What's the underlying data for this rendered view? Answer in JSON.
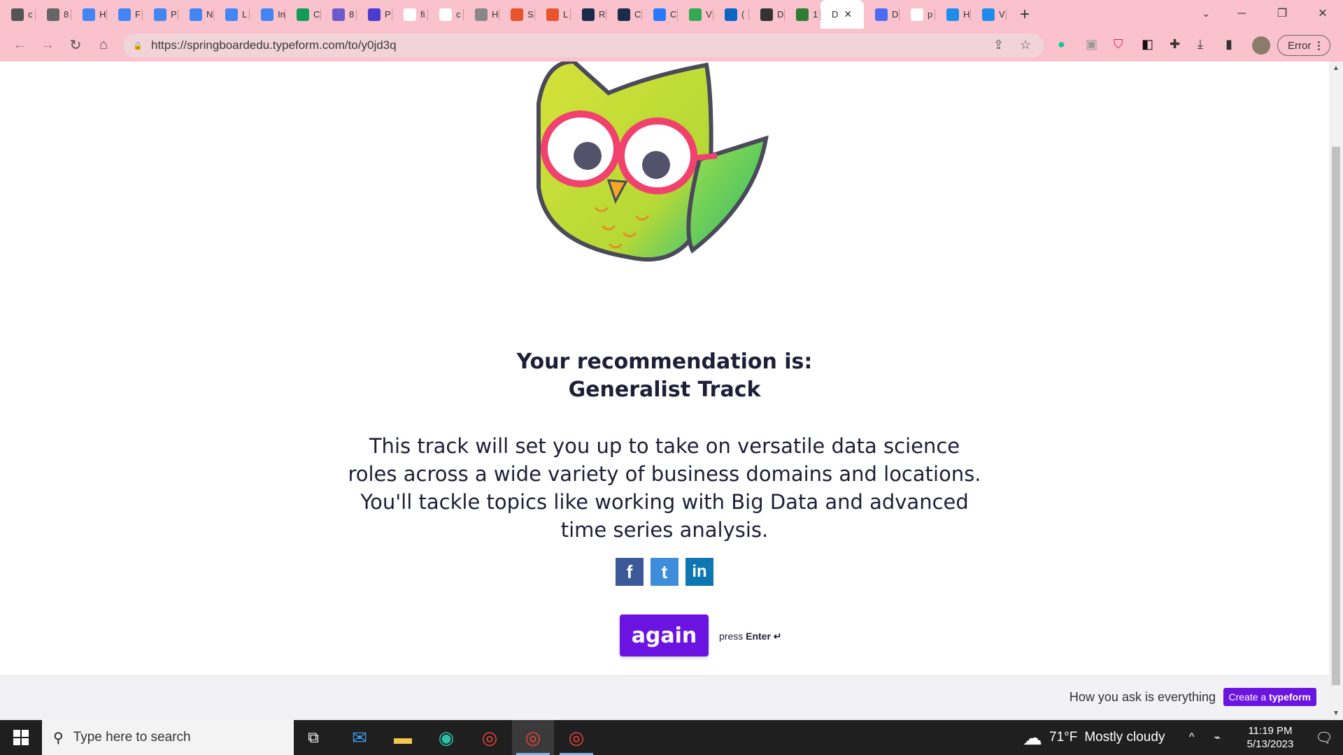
{
  "browser": {
    "tabs": [
      {
        "icon": "grid-doc-icon",
        "label": "c",
        "color": "#555555"
      },
      {
        "icon": "photo-icon",
        "label": "8",
        "color": "#666666"
      },
      {
        "icon": "docs-icon",
        "label": "H",
        "color": "#4285f4"
      },
      {
        "icon": "docs-icon",
        "label": "F",
        "color": "#4285f4"
      },
      {
        "icon": "docs-icon",
        "label": "P",
        "color": "#4285f4"
      },
      {
        "icon": "docs-icon",
        "label": "N",
        "color": "#4285f4"
      },
      {
        "icon": "docs-icon",
        "label": "L",
        "color": "#4285f4"
      },
      {
        "icon": "docs-icon",
        "label": "In",
        "color": "#4285f4"
      },
      {
        "icon": "sheets-plus-icon",
        "label": "C",
        "color": "#0f9d58"
      },
      {
        "icon": "chart-icon",
        "label": "8",
        "color": "#6a5acd"
      },
      {
        "icon": "form-icon",
        "label": "P",
        "color": "#4b3bd1"
      },
      {
        "icon": "google-icon",
        "label": "fi",
        "color": "#ffffff"
      },
      {
        "icon": "google-icon",
        "label": "c",
        "color": "#ffffff"
      },
      {
        "icon": "card-icon",
        "label": "H",
        "color": "#888888"
      },
      {
        "icon": "zap-icon",
        "label": "S",
        "color": "#e8542e"
      },
      {
        "icon": "zap-icon",
        "label": "L",
        "color": "#e8542e"
      },
      {
        "icon": "bank-icon",
        "label": "R",
        "color": "#1a2b4c"
      },
      {
        "icon": "bank-icon",
        "label": "C",
        "color": "#1a2b4c"
      },
      {
        "icon": "chart-bar-icon",
        "label": "C",
        "color": "#2979ff"
      },
      {
        "icon": "green-doc-icon",
        "label": "V",
        "color": "#34a853"
      },
      {
        "icon": "linkedin-icon",
        "label": "(",
        "color": "#0a66c2"
      },
      {
        "icon": "info-icon",
        "label": "D",
        "color": "#333333"
      },
      {
        "icon": "green-dot-icon",
        "label": "1",
        "color": "#2e7d32"
      },
      {
        "icon": "",
        "label": "D",
        "color": "#ffffff",
        "active": true
      },
      {
        "icon": "blue-circle-icon",
        "label": "D",
        "color": "#4a6cf7"
      },
      {
        "icon": "google-icon",
        "label": "p",
        "color": "#ffffff"
      },
      {
        "icon": "k-icon",
        "label": "H",
        "color": "#1f8ceb"
      },
      {
        "icon": "k-icon",
        "label": "V",
        "color": "#1f8ceb"
      }
    ],
    "new_tab": "+",
    "url": "https://springboardedu.typeform.com/to/y0jd3q",
    "error_chip": "Error"
  },
  "page": {
    "recommendation_label": "Your recommendation is:",
    "recommendation_track": "Generalist Track",
    "description": "This track will set you up to take on versatile data science roles across a wide variety of business domains and locations. You'll tackle topics like working with Big Data and advanced time series analysis.",
    "share": {
      "facebook": "f",
      "twitter": "t",
      "linkedin": "in"
    },
    "again_button": "again",
    "press_hint_prefix": "press ",
    "press_hint_key": "Enter ↵",
    "footer_tagline": "How you ask is everything",
    "footer_cta_prefix": "Create a ",
    "footer_cta_brand": "typeform"
  },
  "taskbar": {
    "search_placeholder": "Type here to search",
    "weather_temp": "71°F",
    "weather_desc": "Mostly cloudy",
    "time": "11:19 PM",
    "date": "5/13/2023"
  },
  "colors": {
    "chrome_frame": "#f9c2cc",
    "accent_purple": "#6b13e0",
    "text_dark": "#1e1e37"
  }
}
